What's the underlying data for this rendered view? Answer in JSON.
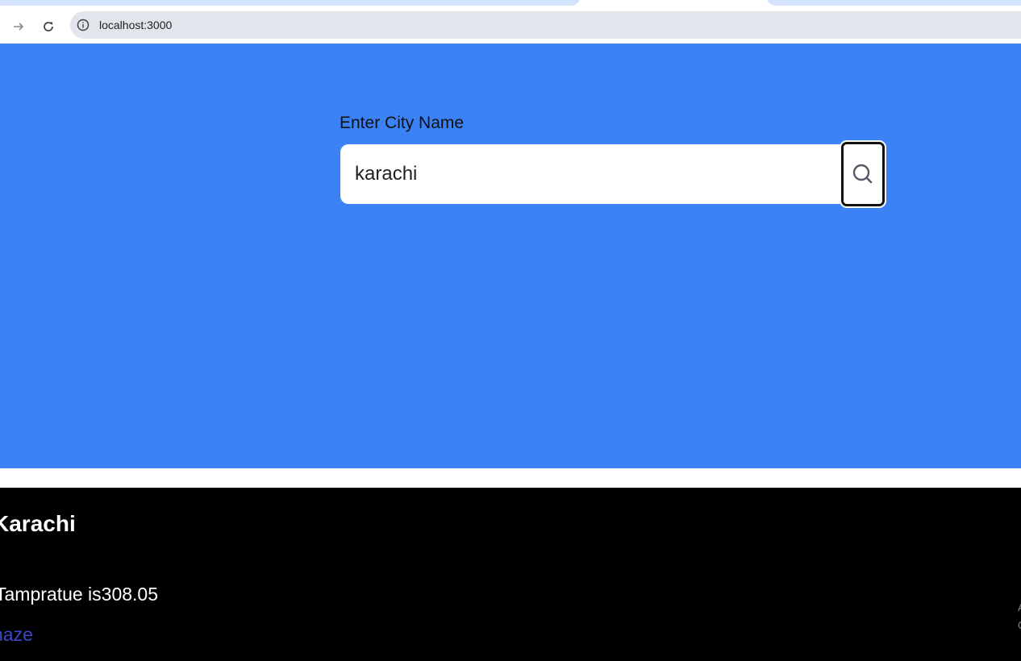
{
  "browser": {
    "url": "localhost:3000",
    "icons": {
      "forward": "arrow-forward-icon",
      "reload": "reload-icon",
      "site_info": "info-icon"
    }
  },
  "search": {
    "label": "Enter City Name",
    "value": "karachi",
    "button_icon": "search-icon"
  },
  "weather": {
    "city": "Karachi",
    "temperature_text": "Tampratue is308.05",
    "condition": "haze"
  },
  "edge_text": [
    "A",
    "C"
  ],
  "colors": {
    "hero_background": "#3b82f6",
    "results_background": "#000000",
    "condition_text": "#3b46c8"
  }
}
